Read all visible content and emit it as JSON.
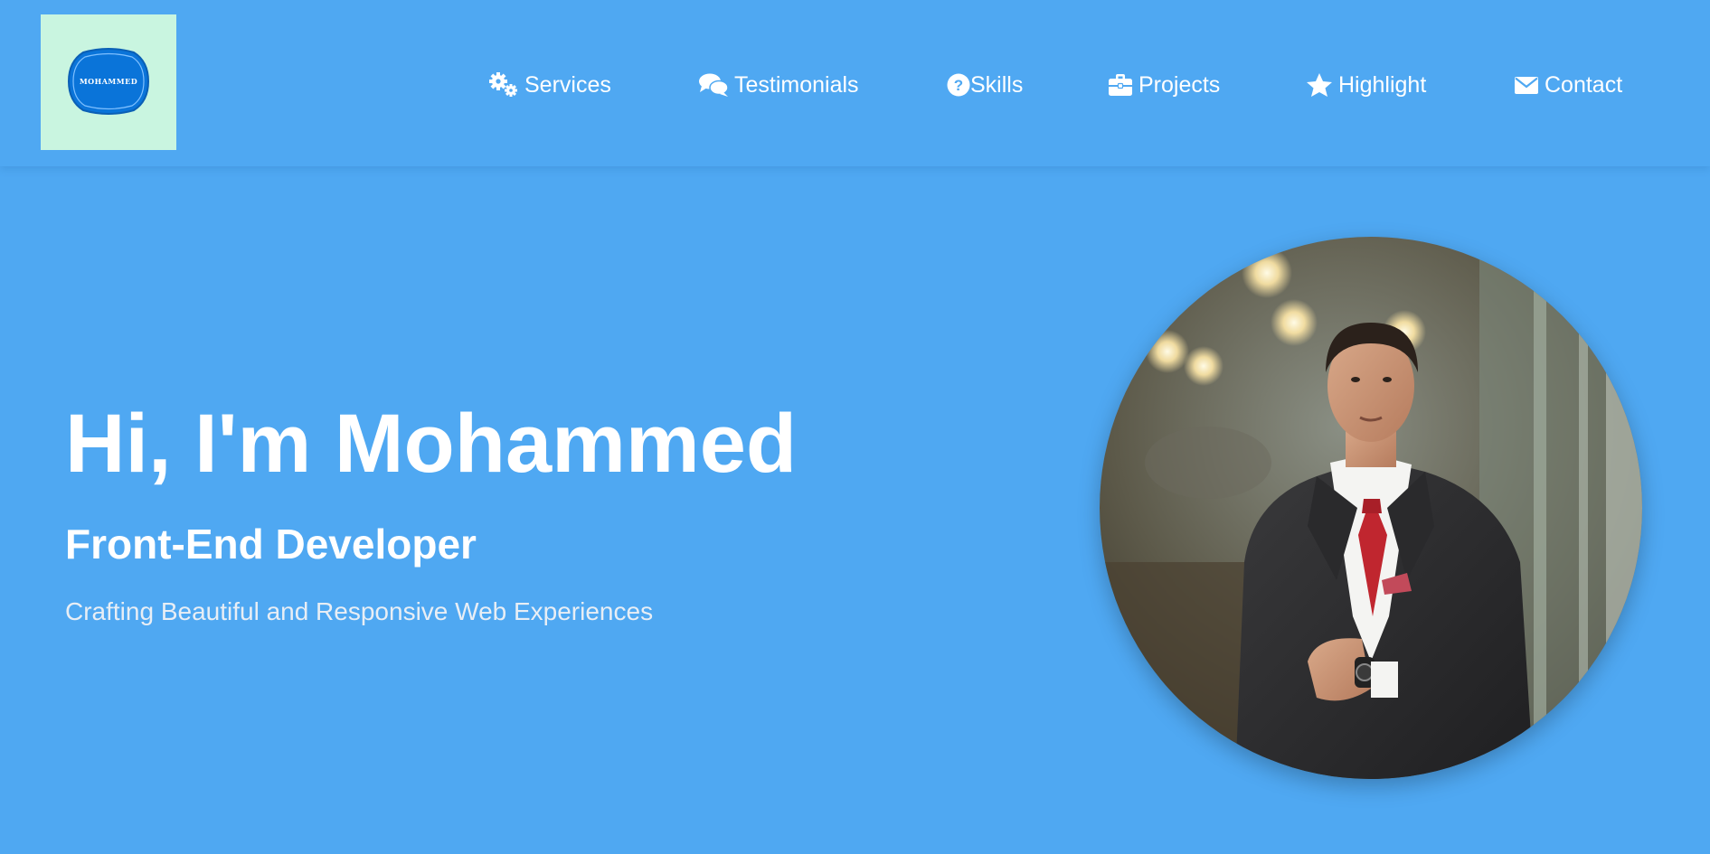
{
  "logo": {
    "text": "MOHAMMED",
    "icon": "badge-logo",
    "colors": {
      "background": "#c9f5e0",
      "badge": "#0a74d9"
    }
  },
  "nav": {
    "items": [
      {
        "label": "Services",
        "icon": "cogs-icon"
      },
      {
        "label": "Testimonials",
        "icon": "comments-icon"
      },
      {
        "label": "Skills",
        "icon": "question-circle-icon"
      },
      {
        "label": "Projects",
        "icon": "briefcase-icon"
      },
      {
        "label": "Highlight",
        "icon": "star-icon"
      },
      {
        "label": "Contact",
        "icon": "envelope-icon"
      }
    ]
  },
  "hero": {
    "title": "Hi, I'm Mohammed",
    "role": "Front-End Developer",
    "tagline": "Crafting Beautiful and Responsive Web Experiences",
    "photo": "profile-photo"
  },
  "colors": {
    "background": "#4fa8f2",
    "text": "#ffffff",
    "tagline": "#e8eef5"
  }
}
